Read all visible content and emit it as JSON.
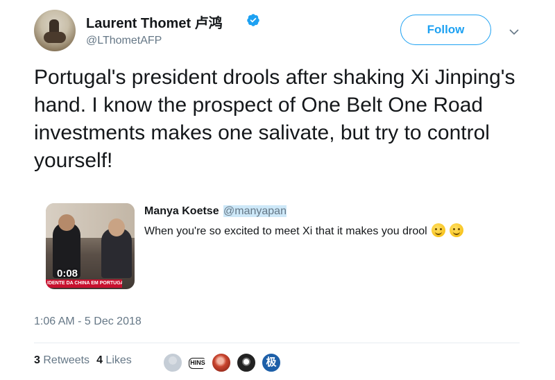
{
  "tweet": {
    "author_name": "Laurent Thomet 卢鸿",
    "author_handle": "@LThometAFP",
    "follow_label": "Follow",
    "text": "Portugal's president drools after shaking Xi Jinping's hand. I know the prospect of One Belt One Road investments makes one salivate, but try to control yourself!",
    "timestamp": "1:06 AM - 5 Dec 2018"
  },
  "quoted_tweet": {
    "author_name": "Manya Koetse",
    "author_handle": "@manyapan",
    "text": "When you're so excited to meet Xi that it makes you drool",
    "emojis": [
      "drooling-face",
      "grinning-squinting-face"
    ],
    "video_duration": "0:08",
    "video_banner": "IDENTE DA CHINA EM PORTUGAL"
  },
  "stats": {
    "retweets_count": "3",
    "retweets_label": "Retweets",
    "likes_count": "4",
    "likes_label": "Likes",
    "liker_avatar_badge": "HINS"
  },
  "colors": {
    "accent": "#1da1f2",
    "secondary_text": "#657786",
    "primary_text": "#14171a",
    "mention_highlight": "#cde8f8"
  }
}
